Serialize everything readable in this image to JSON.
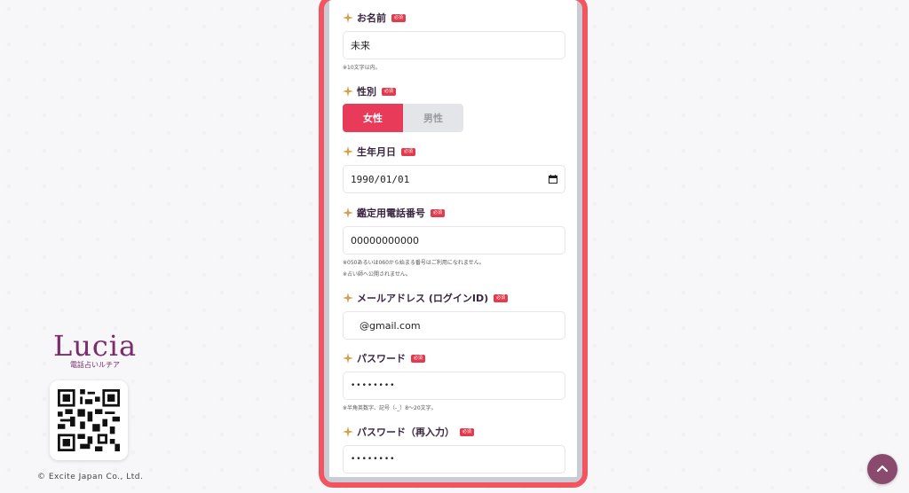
{
  "brand": {
    "logo": "Lucia",
    "logo_sub": "電話占いルチア",
    "copyright": "© Excite Japan Co., Ltd."
  },
  "form": {
    "required_badge": "必須",
    "name": {
      "label": "お名前",
      "value": "未来",
      "note": "※10文字以内。"
    },
    "gender": {
      "label": "性別",
      "options": [
        "女性",
        "男性"
      ],
      "selected": "女性"
    },
    "birthday": {
      "label": "生年月日",
      "value": "1990/01/01"
    },
    "phone": {
      "label": "鑑定用電話番号",
      "value": "00000000000",
      "notes": [
        "※050あるいは060から始まる番号はご利用になれません。",
        "※占い師へ公開されません。"
      ]
    },
    "email": {
      "label": "メールアドレス (ログインID)",
      "value": "@gmail.com"
    },
    "password": {
      "label": "パスワード",
      "value": "••••••••",
      "note": "※半角英数字、記号（-_）8〜20文字。"
    },
    "password_confirm": {
      "label": "パスワード（再入力）",
      "value": "••••••••"
    }
  },
  "colors": {
    "frame": "#f2555f",
    "accent": "#e83b5a",
    "brand": "#7a2c6b",
    "star": "#d4a04a"
  },
  "icons": {
    "star": "sparkle-star-icon",
    "calendar": "calendar-icon",
    "scroll_top": "chevron-up-icon"
  }
}
